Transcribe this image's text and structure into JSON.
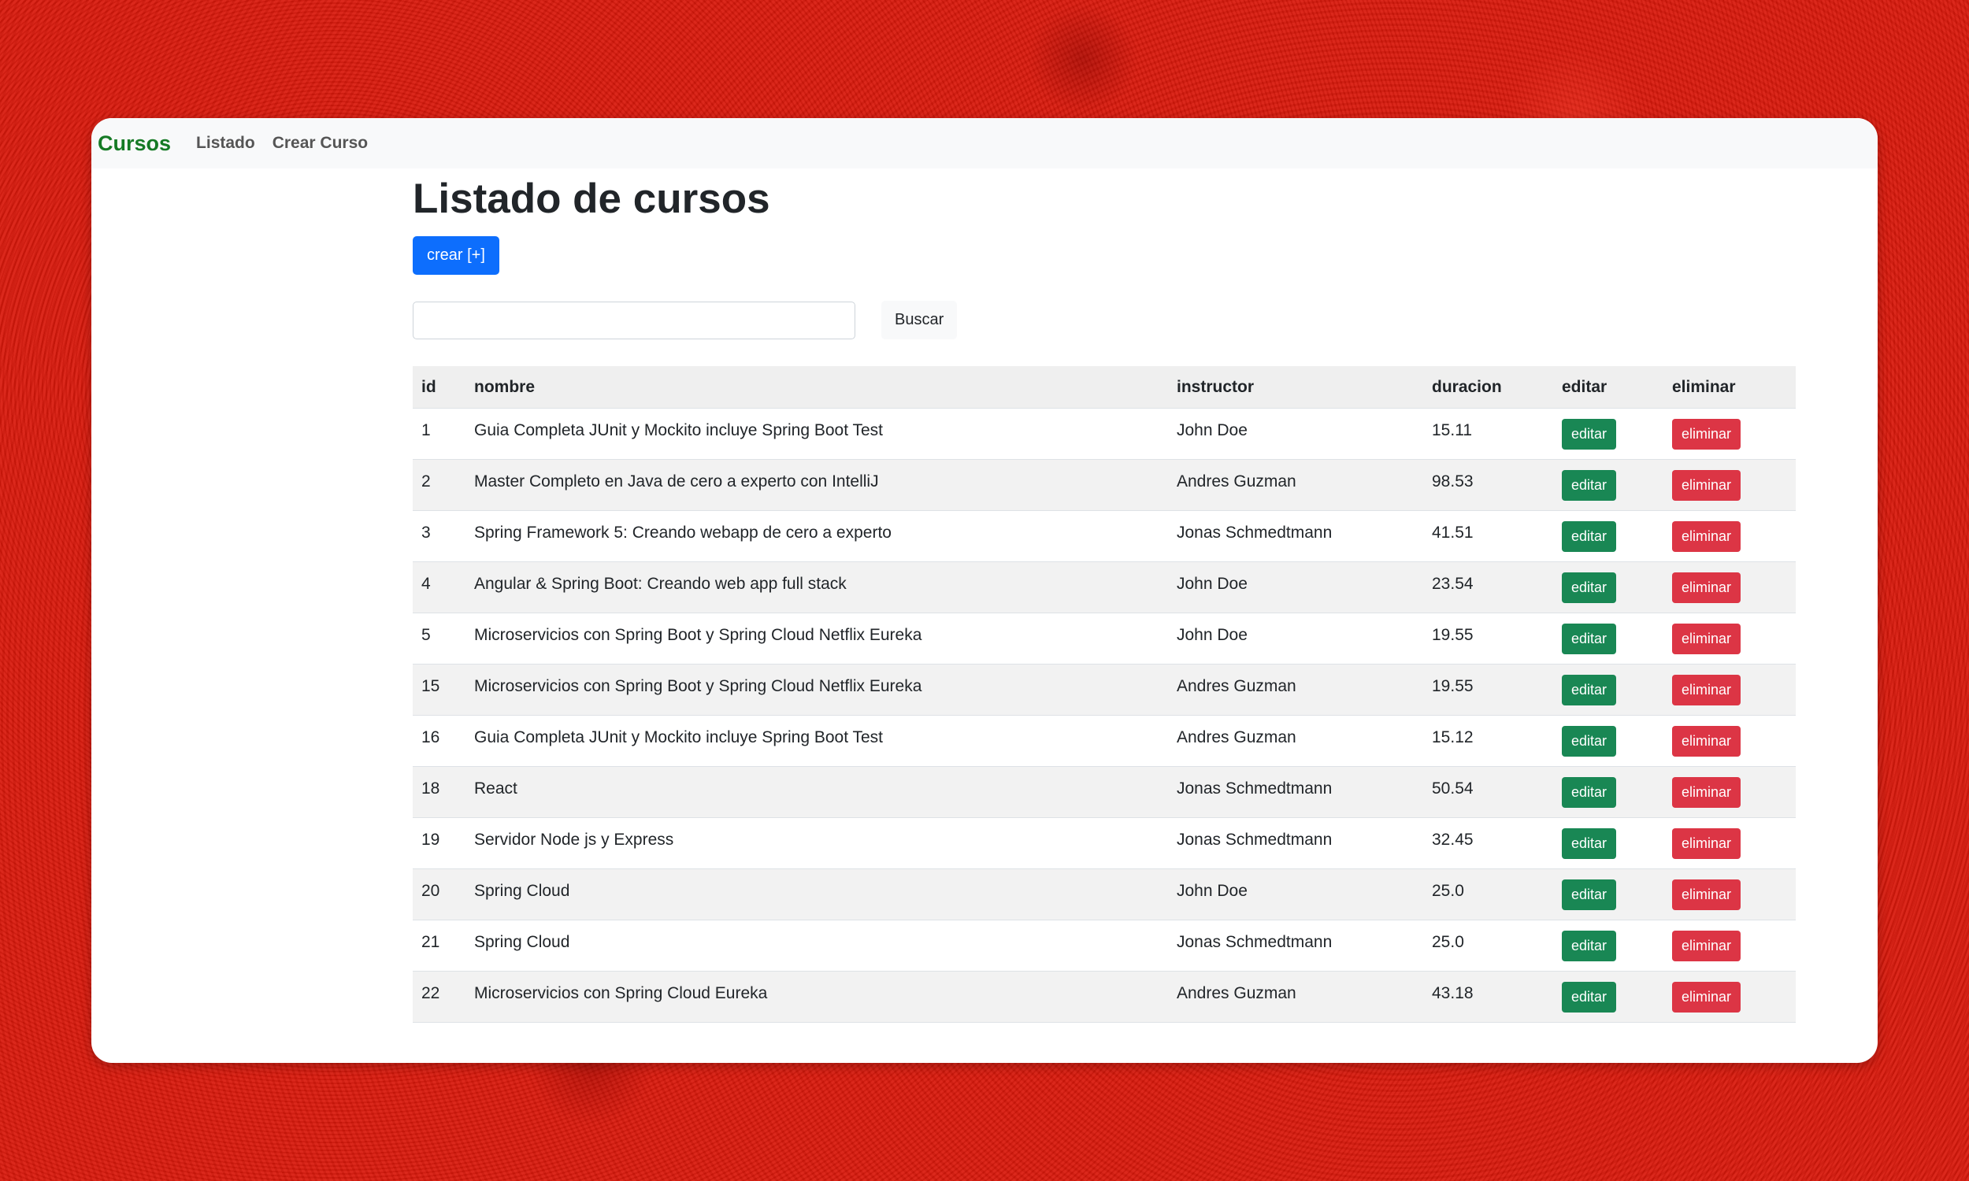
{
  "navbar": {
    "brand": "Cursos",
    "links": [
      "Listado",
      "Crear Curso"
    ]
  },
  "main": {
    "title": "Listado de cursos",
    "create_button": "crear [+]",
    "search_placeholder": "",
    "search_button": "Buscar"
  },
  "table": {
    "headers": [
      "id",
      "nombre",
      "instructor",
      "duracion",
      "editar",
      "eliminar"
    ],
    "edit_label": "editar",
    "delete_label": "eliminar",
    "rows": [
      {
        "id": "1",
        "nombre": "Guia Completa JUnit y Mockito incluye Spring Boot Test",
        "instructor": "John Doe",
        "duracion": "15.11"
      },
      {
        "id": "2",
        "nombre": "Master Completo en Java de cero a experto con IntelliJ",
        "instructor": "Andres Guzman",
        "duracion": "98.53"
      },
      {
        "id": "3",
        "nombre": "Spring Framework 5: Creando webapp de cero a experto",
        "instructor": "Jonas Schmedtmann",
        "duracion": "41.51"
      },
      {
        "id": "4",
        "nombre": "Angular & Spring Boot: Creando web app full stack",
        "instructor": "John Doe",
        "duracion": "23.54"
      },
      {
        "id": "5",
        "nombre": "Microservicios con Spring Boot y Spring Cloud Netflix Eureka",
        "instructor": "John Doe",
        "duracion": "19.55"
      },
      {
        "id": "15",
        "nombre": "Microservicios con Spring Boot y Spring Cloud Netflix Eureka",
        "instructor": "Andres Guzman",
        "duracion": "19.55"
      },
      {
        "id": "16",
        "nombre": "Guia Completa JUnit y Mockito incluye Spring Boot Test",
        "instructor": "Andres Guzman",
        "duracion": "15.12"
      },
      {
        "id": "18",
        "nombre": "React",
        "instructor": "Jonas Schmedtmann",
        "duracion": "50.54"
      },
      {
        "id": "19",
        "nombre": "Servidor Node js y Express",
        "instructor": "Jonas Schmedtmann",
        "duracion": "32.45"
      },
      {
        "id": "20",
        "nombre": "Spring Cloud",
        "instructor": "John Doe",
        "duracion": "25.0"
      },
      {
        "id": "21",
        "nombre": "Spring Cloud",
        "instructor": "Jonas Schmedtmann",
        "duracion": "25.0"
      },
      {
        "id": "22",
        "nombre": "Microservicios con Spring Cloud Eureka",
        "instructor": "Andres Guzman",
        "duracion": "43.18"
      }
    ]
  },
  "colors": {
    "background": "#d9180b",
    "brand": "#157a25",
    "primary": "#0d6efd",
    "success": "#198754",
    "danger": "#dc3545"
  }
}
